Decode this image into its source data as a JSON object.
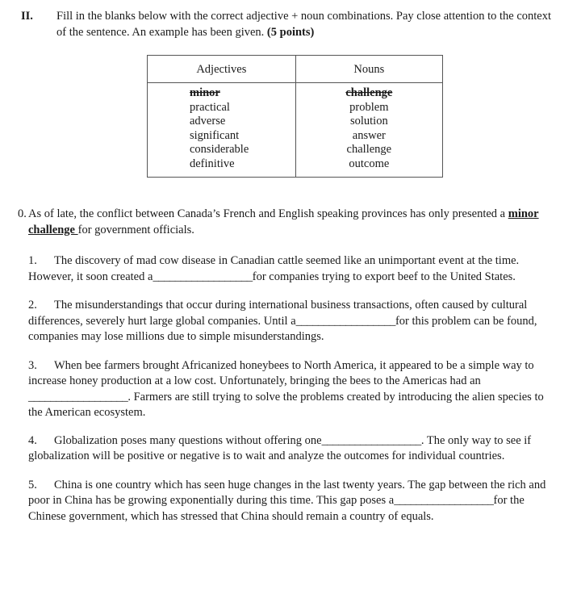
{
  "section": {
    "numeral": "II.",
    "instructions_part1": "Fill in the blanks below with the correct adjective + noun combinations. Pay close attention to the context of the sentence. An example has been given. ",
    "instructions_points": "(5 points)"
  },
  "wordbank": {
    "headers": [
      "Adjectives",
      "Nouns"
    ],
    "adjectives": [
      "minor",
      "practical",
      "adverse",
      "significant",
      "considerable",
      "definitive"
    ],
    "nouns": [
      "challenge",
      "problem",
      "solution",
      "answer",
      "challenge",
      "outcome"
    ],
    "used_adjective": "minor",
    "used_noun": "challenge"
  },
  "example": {
    "number": "0.",
    "text_before": "As of late, the conflict between Canada’s French and English speaking provinces has only presented a ",
    "answer": "minor challenge ",
    "text_after": "for government officials."
  },
  "questions": [
    {
      "number": "1.",
      "text_before": "The discovery of mad cow disease in Canadian cattle seemed like an unimportant event at the time. However, it soon created a",
      "blank": "__________________",
      "text_after": "for companies trying to export beef to the United States."
    },
    {
      "number": "2.",
      "text_before": "The misunderstandings that occur during international business transactions, often caused by cultural differences, severely hurt large global companies. Until a",
      "blank": "__________________",
      "text_after": "for this problem can be found, companies may lose millions due to simple misunderstandings."
    },
    {
      "number": "3.",
      "text_before": "When bee farmers brought Africanized honeybees to North America, it appeared to be a simple way to increase honey production at a low cost. Unfortunately, bringing the bees to the Americas had an ",
      "blank": "__________________",
      "text_after": ". Farmers are still trying to solve the problems created by introducing the alien species to the American ecosystem."
    },
    {
      "number": "4.",
      "text_before": "Globalization poses many questions without offering one",
      "blank": "__________________",
      "text_after": ". The only way to see if globalization will be positive or negative is to wait and analyze the outcomes for individual countries."
    },
    {
      "number": "5.",
      "text_before": "China is one country which has seen huge changes in the last twenty years. The gap between the rich and poor in China has be growing exponentially during this time. This gap poses a",
      "blank": "__________________",
      "text_after": "for the Chinese government, which has stressed that China should remain a country of equals."
    }
  ]
}
